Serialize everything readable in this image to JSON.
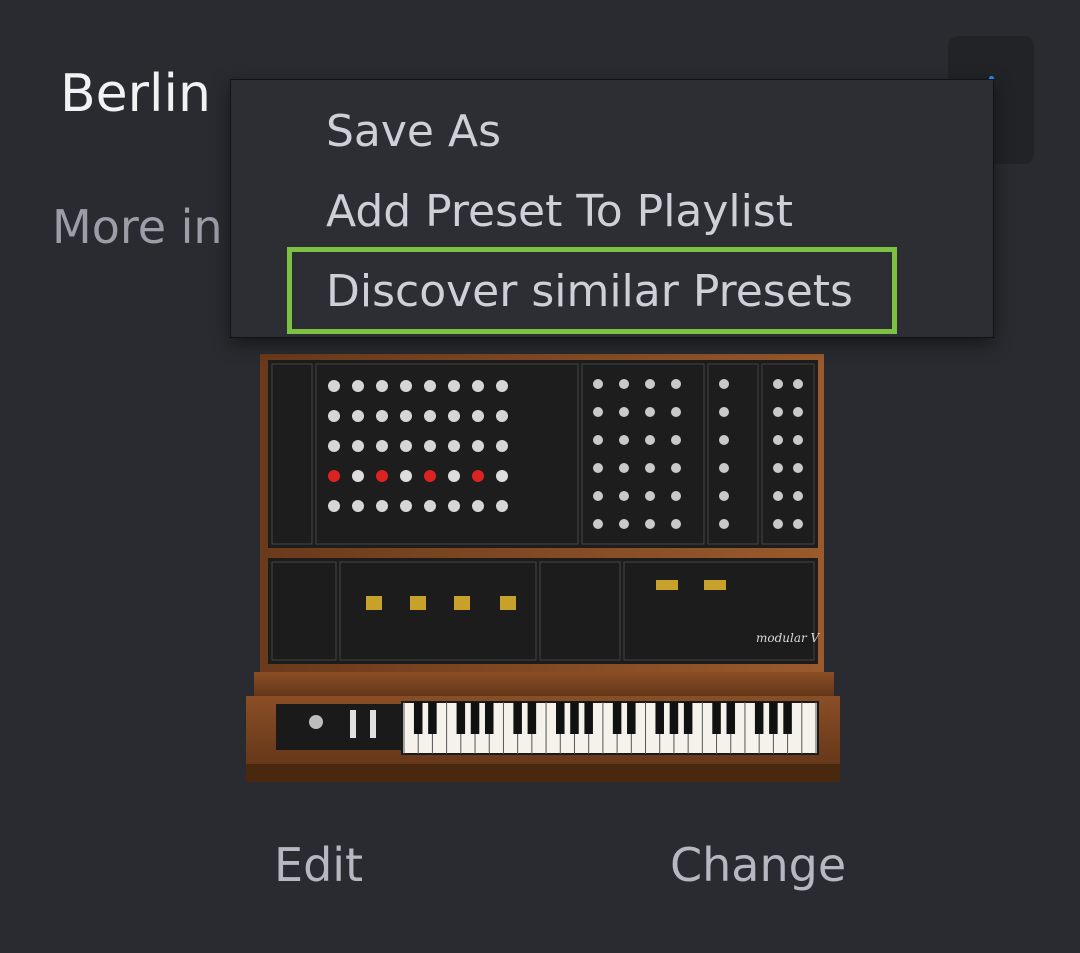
{
  "preset": {
    "title": "Berlin",
    "more_info": "More in"
  },
  "menu": {
    "items": [
      {
        "label": "Save As"
      },
      {
        "label": "Add Preset To Playlist"
      },
      {
        "label": "Discover similar Presets"
      }
    ]
  },
  "instrument": {
    "name": "Modular V",
    "logo_text": "modular V"
  },
  "actions": {
    "edit": "Edit",
    "change": "Change"
  },
  "colors": {
    "background": "#2a2b30",
    "highlight": "#7cc242",
    "accent": "#1e8fff"
  }
}
